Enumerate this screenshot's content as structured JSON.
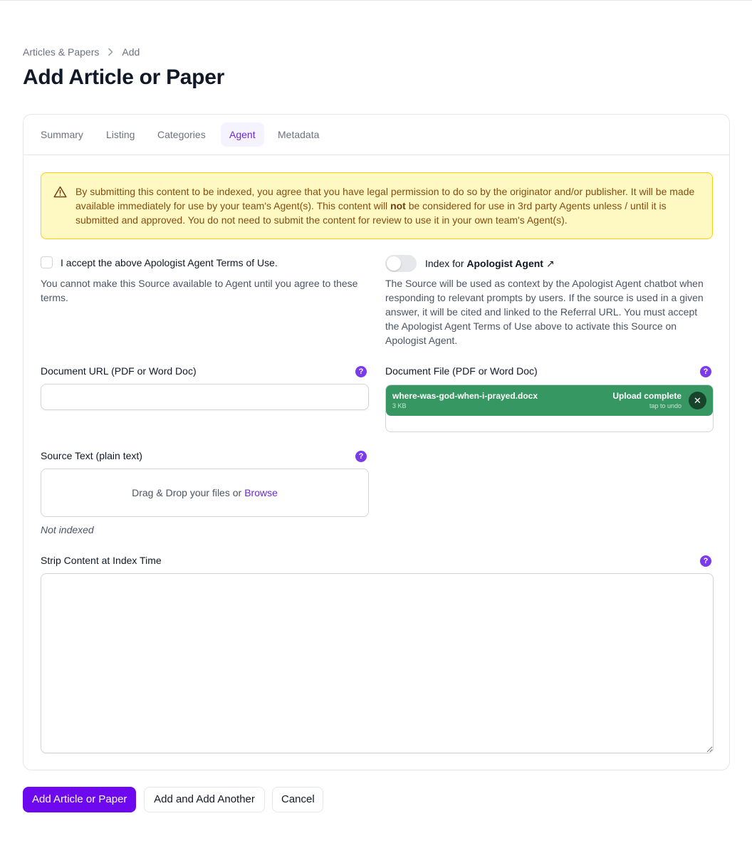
{
  "breadcrumb": {
    "parent": "Articles & Papers",
    "current": "Add"
  },
  "page": {
    "title": "Add Article or Paper"
  },
  "tabs": [
    {
      "label": "Summary"
    },
    {
      "label": "Listing"
    },
    {
      "label": "Categories"
    },
    {
      "label": "Agent",
      "active": true
    },
    {
      "label": "Metadata"
    }
  ],
  "warning": {
    "text_1": "By submitting this content to be indexed, you agree that you have legal permission to do so by the originator and/or publisher. It will be made available immediately for use by your team's Agent(s). This content will ",
    "text_bold": "not",
    "text_2": " be considered for use in 3rd party Agents unless / until it is submitted and approved. You do not need to submit the content for review to use it in your own team's Agent(s)."
  },
  "terms": {
    "label": "I accept the above Apologist Agent Terms of Use.",
    "checked": false,
    "helper": "You cannot make this Source available to Agent until you agree to these terms."
  },
  "index_toggle": {
    "label_prefix": "Index for ",
    "label_link": "Apologist Agent",
    "link_icon": "↗",
    "enabled": false,
    "helper": "The Source will be used as context by the Apologist Agent chatbot when responding to relevant prompts by users. If the source is used in a given answer, it will be cited and linked to the Referral URL. You must accept the Apologist Agent Terms of Use above to activate this Source on Apologist Agent."
  },
  "document_url": {
    "label": "Document URL (PDF or Word Doc)",
    "value": "",
    "placeholder": ""
  },
  "document_file": {
    "label": "Document File (PDF or Word Doc)",
    "file_name": "where-was-god-when-i-prayed.docx",
    "file_size": "3 KB",
    "status": "Upload complete",
    "undo": "tap to undo",
    "close_glyph": "✕"
  },
  "source_text": {
    "label": "Source Text (plain text)",
    "dropzone_text": "Drag & Drop your files or",
    "browse_label": "Browse",
    "status": "Not indexed"
  },
  "strip_content": {
    "label": "Strip Content at Index Time",
    "value": ""
  },
  "help_glyph": "?",
  "actions": {
    "primary": "Add Article or Paper",
    "add_another": "Add and Add Another",
    "cancel": "Cancel"
  },
  "colors": {
    "accent": "#6d08ef",
    "tab_active_text": "#6d28d9",
    "warning_bg": "#fef9c3",
    "warning_border": "#facc15",
    "upload_success": "#369763"
  }
}
